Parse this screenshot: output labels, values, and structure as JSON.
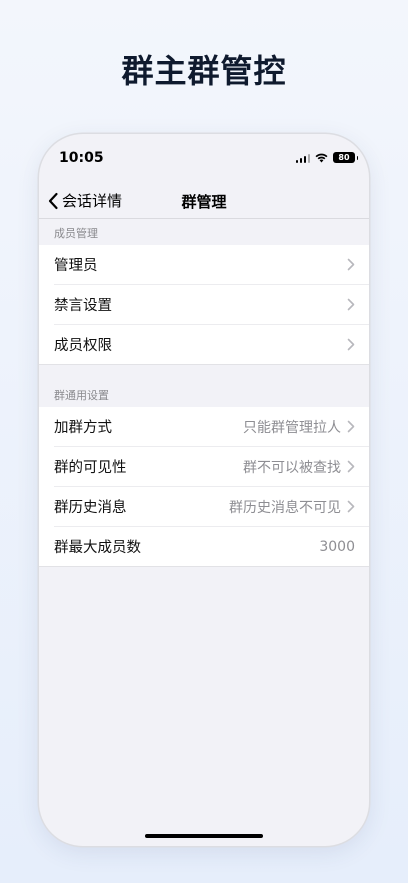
{
  "page_heading": "群主群管控",
  "status_bar": {
    "time": "10:05",
    "battery_level": "80"
  },
  "nav": {
    "back_label": "会话详情",
    "title": "群管理"
  },
  "sections": [
    {
      "header": "成员管理",
      "rows": [
        {
          "label": "管理员",
          "value": "",
          "chevron": true
        },
        {
          "label": "禁言设置",
          "value": "",
          "chevron": true
        },
        {
          "label": "成员权限",
          "value": "",
          "chevron": true
        }
      ]
    },
    {
      "header": "群通用设置",
      "rows": [
        {
          "label": "加群方式",
          "value": "只能群管理拉人",
          "chevron": true
        },
        {
          "label": "群的可见性",
          "value": "群不可以被查找",
          "chevron": true
        },
        {
          "label": "群历史消息",
          "value": "群历史消息不可见",
          "chevron": true
        },
        {
          "label": "群最大成员数",
          "value": "3000",
          "chevron": false
        }
      ]
    }
  ]
}
